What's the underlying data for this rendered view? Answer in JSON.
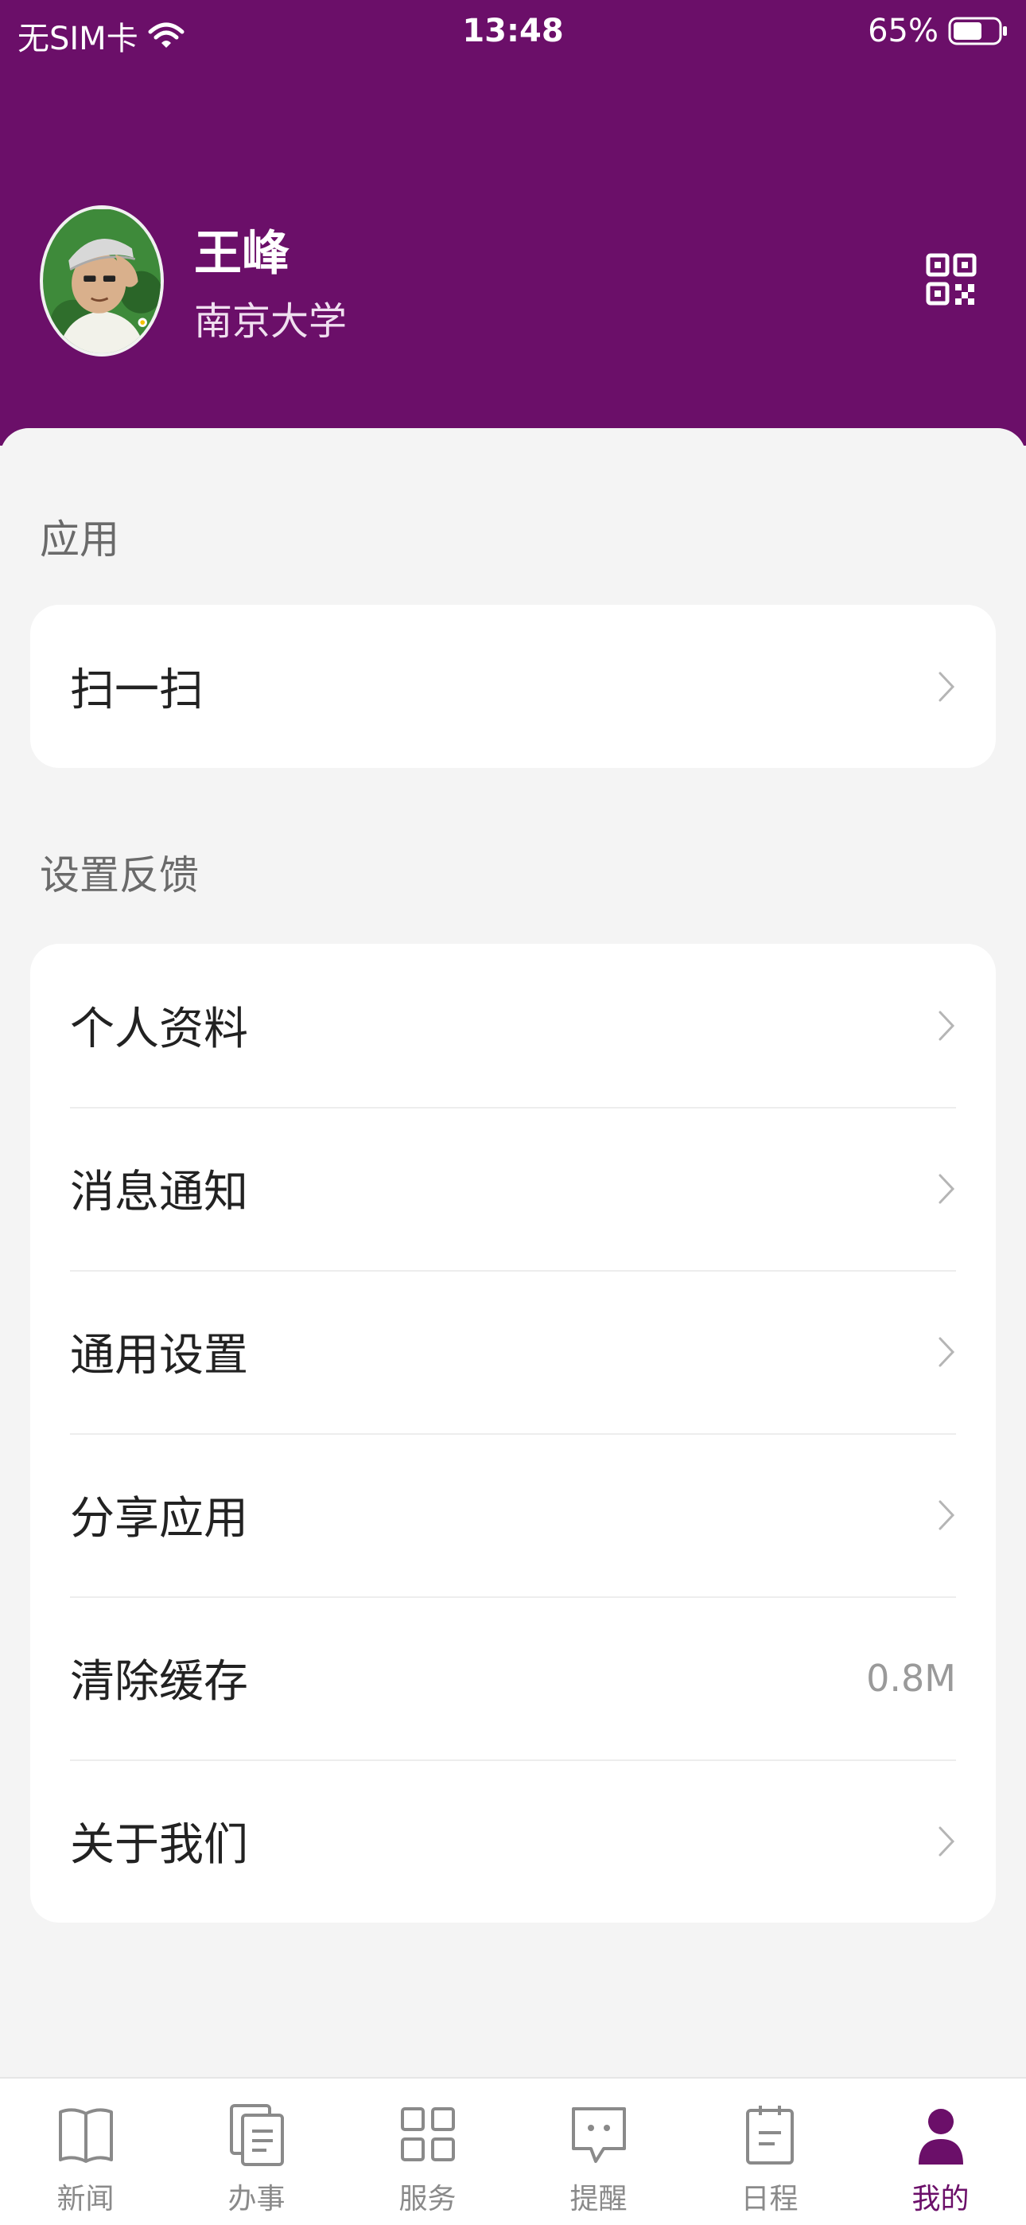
{
  "status_bar": {
    "carrier": "无SIM卡",
    "time": "13:48",
    "battery": "65%",
    "battery_level": 0.65
  },
  "profile": {
    "name": "王峰",
    "school": "南京大学",
    "avatar_icon": "cartoon-boy-avatar",
    "qr_icon": "qr-code-icon"
  },
  "sections": {
    "apps": {
      "title": "应用",
      "items": [
        {
          "label": "扫一扫"
        }
      ]
    },
    "settings": {
      "title": "设置反馈",
      "items": [
        {
          "label": "个人资料"
        },
        {
          "label": "消息通知"
        },
        {
          "label": "通用设置"
        },
        {
          "label": "分享应用"
        },
        {
          "label": "清除缓存",
          "value": "0.8M"
        },
        {
          "label": "关于我们"
        }
      ]
    }
  },
  "tabbar": {
    "tabs": [
      {
        "label": "新闻",
        "icon": "book-icon"
      },
      {
        "label": "办事",
        "icon": "document-icon"
      },
      {
        "label": "服务",
        "icon": "grid-icon"
      },
      {
        "label": "提醒",
        "icon": "chat-bubble-icon"
      },
      {
        "label": "日程",
        "icon": "clipboard-icon"
      },
      {
        "label": "我的",
        "icon": "person-icon"
      }
    ],
    "active_index": 5
  },
  "colors": {
    "brand": "#6b0f69",
    "background": "#f4f4f4",
    "inactive_tab": "#8a8a8a"
  }
}
